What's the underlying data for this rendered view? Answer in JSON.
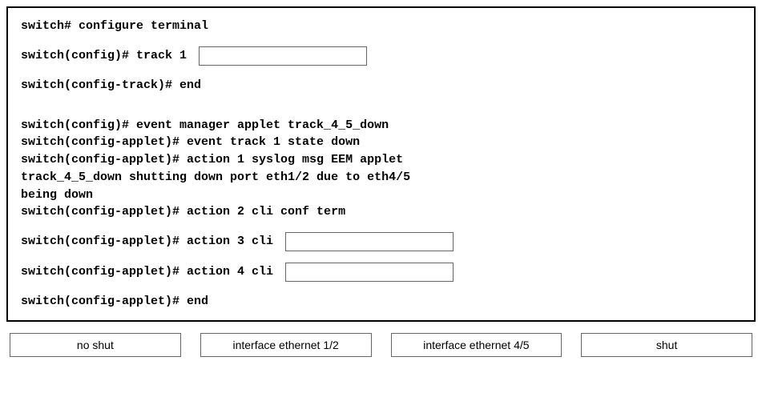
{
  "terminal": {
    "line1": "switch# configure terminal",
    "line2_pre": "switch(config)# track 1 ",
    "line3": "switch(config-track)# end",
    "line4": "switch(config)# event manager applet track_4_5_down",
    "line5": "switch(config-applet)# event track 1 state down",
    "line6": "switch(config-applet)# action 1 syslog msg EEM applet",
    "line7": "track_4_5_down shutting down port eth1/2 due to eth4/5",
    "line8": "being down",
    "line9": "switch(config-applet)# action 2 cli conf term",
    "line10_pre": "switch(config-applet)# action 3 cli ",
    "line11_pre": "switch(config-applet)# action 4 cli ",
    "line12": "switch(config-applet)# end"
  },
  "options": [
    "no shut",
    "interface ethernet 1/2",
    "interface ethernet 4/5",
    "shut"
  ]
}
